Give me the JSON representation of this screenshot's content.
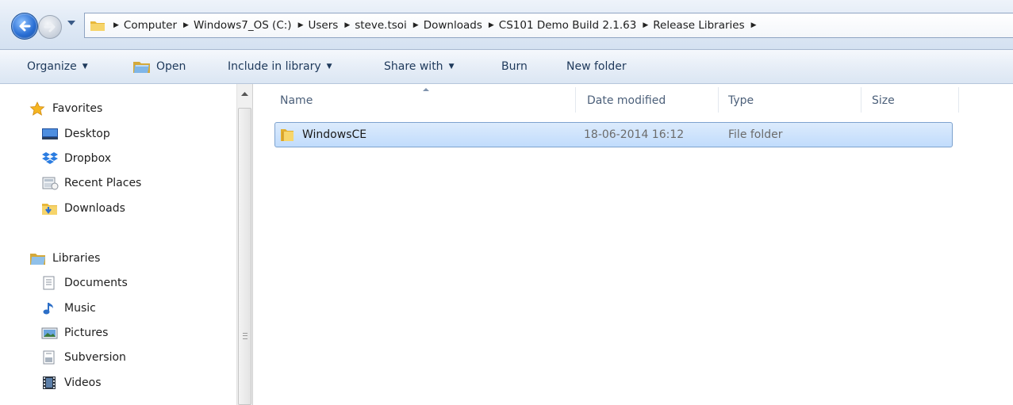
{
  "address_bar": {
    "breadcrumbs": [
      "Computer",
      "Windows7_OS (C:)",
      "Users",
      "steve.tsoi",
      "Downloads",
      "CS101 Demo Build 2.1.63",
      "Release Libraries"
    ]
  },
  "command_bar": {
    "organize": "Organize",
    "open": "Open",
    "include_in_library": "Include in library",
    "share_with": "Share with",
    "burn": "Burn",
    "new_folder": "New folder"
  },
  "navigation_pane": {
    "favorites": {
      "header": "Favorites",
      "items": [
        {
          "label": "Desktop",
          "icon": "desktop-icon"
        },
        {
          "label": "Dropbox",
          "icon": "dropbox-icon"
        },
        {
          "label": "Recent Places",
          "icon": "recent-places-icon"
        },
        {
          "label": "Downloads",
          "icon": "downloads-folder-icon"
        }
      ]
    },
    "libraries": {
      "header": "Libraries",
      "items": [
        {
          "label": "Documents",
          "icon": "documents-icon"
        },
        {
          "label": "Music",
          "icon": "music-icon"
        },
        {
          "label": "Pictures",
          "icon": "pictures-icon"
        },
        {
          "label": "Subversion",
          "icon": "subversion-icon"
        },
        {
          "label": "Videos",
          "icon": "videos-icon"
        }
      ]
    }
  },
  "file_list": {
    "columns": [
      "Name",
      "Date modified",
      "Type",
      "Size"
    ],
    "sorted_by": "Name",
    "rows": [
      {
        "name": "WindowsCE",
        "date_modified": "18-06-2014 16:12",
        "type": "File folder",
        "size": "",
        "selected": true,
        "icon": "folder-icon"
      }
    ]
  },
  "colors": {
    "selection_fill": "#cde4fc",
    "selection_border": "#7da2ce",
    "header_text": "#4c607a",
    "command_text": "#1e395b",
    "folder_yellow": "#f3c64a"
  }
}
